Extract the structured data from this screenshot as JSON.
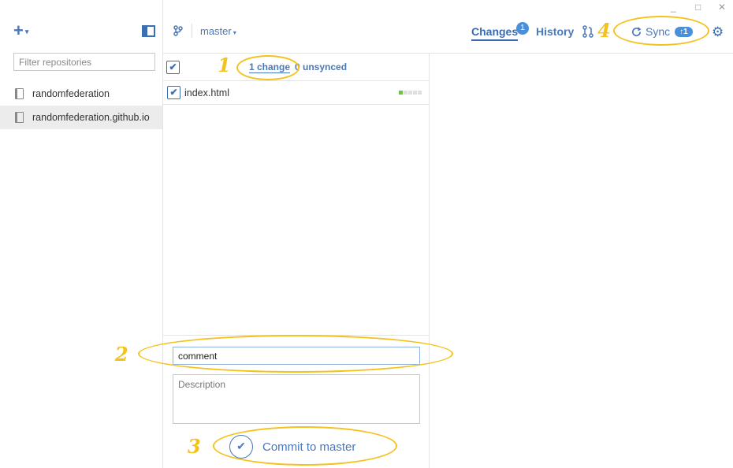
{
  "sidebar": {
    "add_icon": "plus-icon",
    "add_caret": "▾",
    "filter_placeholder": "Filter repositories",
    "repos": [
      {
        "name": "randomfederation"
      },
      {
        "name": "randomfederation.github.io",
        "selected": true
      }
    ]
  },
  "header": {
    "branch": "master",
    "branch_caret": "▾",
    "tabs": {
      "changes": "Changes",
      "changes_badge": "1",
      "history": "History"
    },
    "sync": {
      "label": "Sync",
      "count": "↑1"
    },
    "gear": "⚙"
  },
  "window": {
    "min": "_",
    "max": "□",
    "close": "✕"
  },
  "changes": {
    "count_label": "1 change",
    "unsynced_label": "0 unsynced",
    "files": [
      {
        "name": "index.html",
        "checked": true
      }
    ]
  },
  "commit": {
    "summary_value": "comment",
    "description_placeholder": "Description",
    "button_label": "Commit to master",
    "button_icon": "✔"
  },
  "annotations": [
    "1",
    "2",
    "3",
    "4"
  ],
  "colors": {
    "accent": "#4a78b8",
    "annotation": "#f4c21c",
    "diff_add": "#6cc644"
  }
}
